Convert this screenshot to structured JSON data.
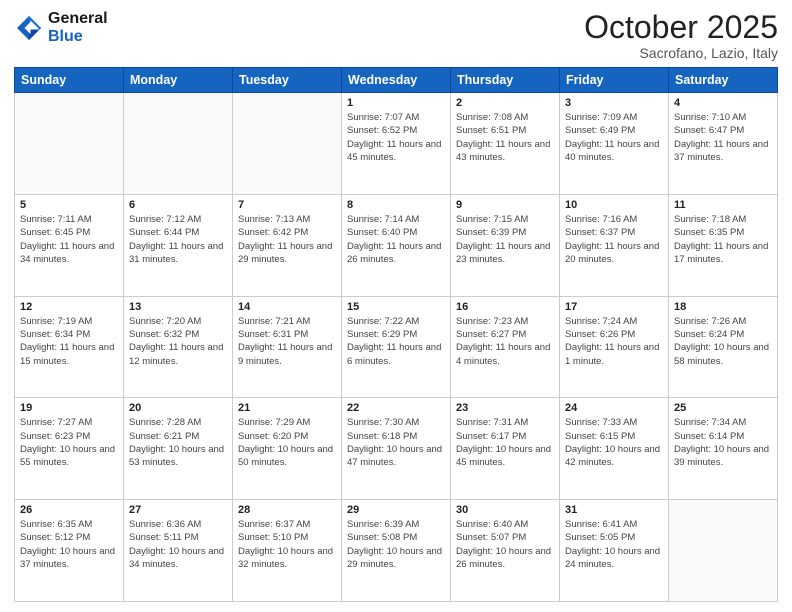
{
  "header": {
    "logo_general": "General",
    "logo_blue": "Blue",
    "title": "October 2025",
    "subtitle": "Sacrofano, Lazio, Italy"
  },
  "days_of_week": [
    "Sunday",
    "Monday",
    "Tuesday",
    "Wednesday",
    "Thursday",
    "Friday",
    "Saturday"
  ],
  "weeks": [
    [
      {
        "day": "",
        "info": ""
      },
      {
        "day": "",
        "info": ""
      },
      {
        "day": "",
        "info": ""
      },
      {
        "day": "1",
        "info": "Sunrise: 7:07 AM\nSunset: 6:52 PM\nDaylight: 11 hours and 45 minutes."
      },
      {
        "day": "2",
        "info": "Sunrise: 7:08 AM\nSunset: 6:51 PM\nDaylight: 11 hours and 43 minutes."
      },
      {
        "day": "3",
        "info": "Sunrise: 7:09 AM\nSunset: 6:49 PM\nDaylight: 11 hours and 40 minutes."
      },
      {
        "day": "4",
        "info": "Sunrise: 7:10 AM\nSunset: 6:47 PM\nDaylight: 11 hours and 37 minutes."
      }
    ],
    [
      {
        "day": "5",
        "info": "Sunrise: 7:11 AM\nSunset: 6:45 PM\nDaylight: 11 hours and 34 minutes."
      },
      {
        "day": "6",
        "info": "Sunrise: 7:12 AM\nSunset: 6:44 PM\nDaylight: 11 hours and 31 minutes."
      },
      {
        "day": "7",
        "info": "Sunrise: 7:13 AM\nSunset: 6:42 PM\nDaylight: 11 hours and 29 minutes."
      },
      {
        "day": "8",
        "info": "Sunrise: 7:14 AM\nSunset: 6:40 PM\nDaylight: 11 hours and 26 minutes."
      },
      {
        "day": "9",
        "info": "Sunrise: 7:15 AM\nSunset: 6:39 PM\nDaylight: 11 hours and 23 minutes."
      },
      {
        "day": "10",
        "info": "Sunrise: 7:16 AM\nSunset: 6:37 PM\nDaylight: 11 hours and 20 minutes."
      },
      {
        "day": "11",
        "info": "Sunrise: 7:18 AM\nSunset: 6:35 PM\nDaylight: 11 hours and 17 minutes."
      }
    ],
    [
      {
        "day": "12",
        "info": "Sunrise: 7:19 AM\nSunset: 6:34 PM\nDaylight: 11 hours and 15 minutes."
      },
      {
        "day": "13",
        "info": "Sunrise: 7:20 AM\nSunset: 6:32 PM\nDaylight: 11 hours and 12 minutes."
      },
      {
        "day": "14",
        "info": "Sunrise: 7:21 AM\nSunset: 6:31 PM\nDaylight: 11 hours and 9 minutes."
      },
      {
        "day": "15",
        "info": "Sunrise: 7:22 AM\nSunset: 6:29 PM\nDaylight: 11 hours and 6 minutes."
      },
      {
        "day": "16",
        "info": "Sunrise: 7:23 AM\nSunset: 6:27 PM\nDaylight: 11 hours and 4 minutes."
      },
      {
        "day": "17",
        "info": "Sunrise: 7:24 AM\nSunset: 6:26 PM\nDaylight: 11 hours and 1 minute."
      },
      {
        "day": "18",
        "info": "Sunrise: 7:26 AM\nSunset: 6:24 PM\nDaylight: 10 hours and 58 minutes."
      }
    ],
    [
      {
        "day": "19",
        "info": "Sunrise: 7:27 AM\nSunset: 6:23 PM\nDaylight: 10 hours and 55 minutes."
      },
      {
        "day": "20",
        "info": "Sunrise: 7:28 AM\nSunset: 6:21 PM\nDaylight: 10 hours and 53 minutes."
      },
      {
        "day": "21",
        "info": "Sunrise: 7:29 AM\nSunset: 6:20 PM\nDaylight: 10 hours and 50 minutes."
      },
      {
        "day": "22",
        "info": "Sunrise: 7:30 AM\nSunset: 6:18 PM\nDaylight: 10 hours and 47 minutes."
      },
      {
        "day": "23",
        "info": "Sunrise: 7:31 AM\nSunset: 6:17 PM\nDaylight: 10 hours and 45 minutes."
      },
      {
        "day": "24",
        "info": "Sunrise: 7:33 AM\nSunset: 6:15 PM\nDaylight: 10 hours and 42 minutes."
      },
      {
        "day": "25",
        "info": "Sunrise: 7:34 AM\nSunset: 6:14 PM\nDaylight: 10 hours and 39 minutes."
      }
    ],
    [
      {
        "day": "26",
        "info": "Sunrise: 6:35 AM\nSunset: 5:12 PM\nDaylight: 10 hours and 37 minutes."
      },
      {
        "day": "27",
        "info": "Sunrise: 6:36 AM\nSunset: 5:11 PM\nDaylight: 10 hours and 34 minutes."
      },
      {
        "day": "28",
        "info": "Sunrise: 6:37 AM\nSunset: 5:10 PM\nDaylight: 10 hours and 32 minutes."
      },
      {
        "day": "29",
        "info": "Sunrise: 6:39 AM\nSunset: 5:08 PM\nDaylight: 10 hours and 29 minutes."
      },
      {
        "day": "30",
        "info": "Sunrise: 6:40 AM\nSunset: 5:07 PM\nDaylight: 10 hours and 26 minutes."
      },
      {
        "day": "31",
        "info": "Sunrise: 6:41 AM\nSunset: 5:05 PM\nDaylight: 10 hours and 24 minutes."
      },
      {
        "day": "",
        "info": ""
      }
    ]
  ]
}
